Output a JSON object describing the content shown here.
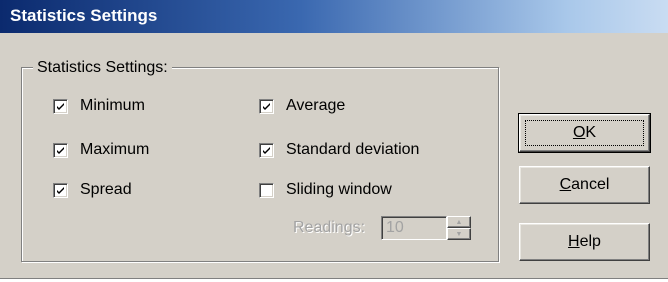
{
  "window": {
    "title": "Statistics Settings"
  },
  "group": {
    "label": "Statistics Settings:"
  },
  "checkboxes": {
    "minimum": {
      "label": "Minimum",
      "checked": true
    },
    "maximum": {
      "label": "Maximum",
      "checked": true
    },
    "spread": {
      "label": "Spread",
      "checked": true
    },
    "average": {
      "label": "Average",
      "checked": true
    },
    "std_dev": {
      "label": "Standard deviation",
      "checked": true
    },
    "sliding_window": {
      "label": "Sliding window",
      "checked": false
    }
  },
  "readings": {
    "label": "Readings:",
    "value": "10",
    "enabled": false
  },
  "buttons": {
    "ok": {
      "mnemonic": "O",
      "rest": "K"
    },
    "cancel": {
      "mnemonic": "C",
      "rest": "ancel"
    },
    "help": {
      "mnemonic": "H",
      "rest": "elp"
    }
  },
  "colors": {
    "dialog_bg": "#d4d0c8",
    "title_start": "#0b2a6e",
    "title_end": "#c9dcf2",
    "disabled_text": "#a3a3a3"
  },
  "icons": {
    "check": "check-mark-icon",
    "spin_up": "arrow-up-icon",
    "spin_down": "arrow-down-icon"
  }
}
